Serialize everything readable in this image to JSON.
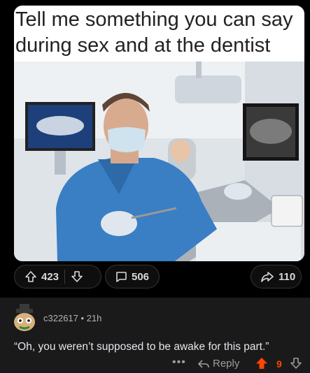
{
  "post": {
    "caption": "Tell me something you can say during sex and at the dentist",
    "upvotes": "423",
    "comments": "506",
    "shares": "110"
  },
  "comment": {
    "author": "c322617",
    "age": "21h",
    "text": "“Oh, you weren’t supposed to be awake for this part.”",
    "more": "•••",
    "reply_label": "Reply",
    "score": "9",
    "upvote_color": "#ff4500"
  }
}
